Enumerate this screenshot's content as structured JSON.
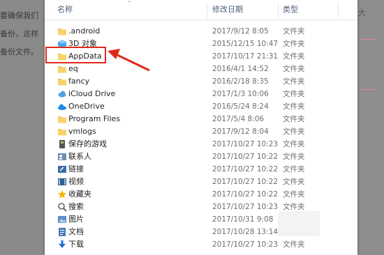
{
  "background": {
    "left_text": [
      "要确保我们",
      "备份，这样",
      "备份文件。"
    ],
    "right_char": "大"
  },
  "columns": {
    "name": "名称",
    "date": "修改日期",
    "type": "类型"
  },
  "colors": {
    "folder": "#f2c34d",
    "highlight": "#e0291b",
    "accent": "#1e88e5"
  },
  "rows": [
    {
      "name": ".android",
      "date": "2017/9/12 8:05",
      "type": "文件夹",
      "icon": "folder-icon"
    },
    {
      "name": "3D 对象",
      "date": "2015/12/15 10:47",
      "type": "文件夹",
      "icon": "3d-objects-icon"
    },
    {
      "name": "AppData",
      "date": "2017/10/17 21:31",
      "type": "文件夹",
      "icon": "folder-icon"
    },
    {
      "name": "eq",
      "date": "2016/4/1 14:52",
      "type": "文件夹",
      "icon": "folder-icon"
    },
    {
      "name": "fancy",
      "date": "2016/2/18 8:35",
      "type": "文件夹",
      "icon": "folder-icon"
    },
    {
      "name": "iCloud Drive",
      "date": "2017/1/3 10:06",
      "type": "文件夹",
      "icon": "icloud-icon"
    },
    {
      "name": "OneDrive",
      "date": "2016/5/24 8:24",
      "type": "文件夹",
      "icon": "onedrive-icon"
    },
    {
      "name": "Program Files",
      "date": "2017/5/4 8:06",
      "type": "文件夹",
      "icon": "folder-icon"
    },
    {
      "name": "vmlogs",
      "date": "2017/9/12 8:04",
      "type": "文件夹",
      "icon": "folder-icon"
    },
    {
      "name": "保存的游戏",
      "date": "2017/10/27 10:23",
      "type": "文件夹",
      "icon": "saved-games-icon"
    },
    {
      "name": "联系人",
      "date": "2017/10/27 10:22",
      "type": "文件夹",
      "icon": "contacts-icon"
    },
    {
      "name": "链接",
      "date": "2017/10/27 10:22",
      "type": "文件夹",
      "icon": "links-icon"
    },
    {
      "name": "视频",
      "date": "2017/10/27 10:22",
      "type": "文件夹",
      "icon": "videos-icon"
    },
    {
      "name": "收藏夹",
      "date": "2017/10/27 10:22",
      "type": "文件夹",
      "icon": "favorites-icon"
    },
    {
      "name": "搜索",
      "date": "2017/10/27 10:23",
      "type": "文件夹",
      "icon": "searches-icon"
    },
    {
      "name": "图片",
      "date": "2017/10/31 9:08",
      "type": "",
      "icon": "pictures-icon"
    },
    {
      "name": "文档",
      "date": "2017/10/28 13:14",
      "type": "",
      "icon": "documents-icon"
    },
    {
      "name": "下载",
      "date": "2017/10/27 10:23",
      "type": "文件夹",
      "icon": "downloads-icon"
    }
  ]
}
